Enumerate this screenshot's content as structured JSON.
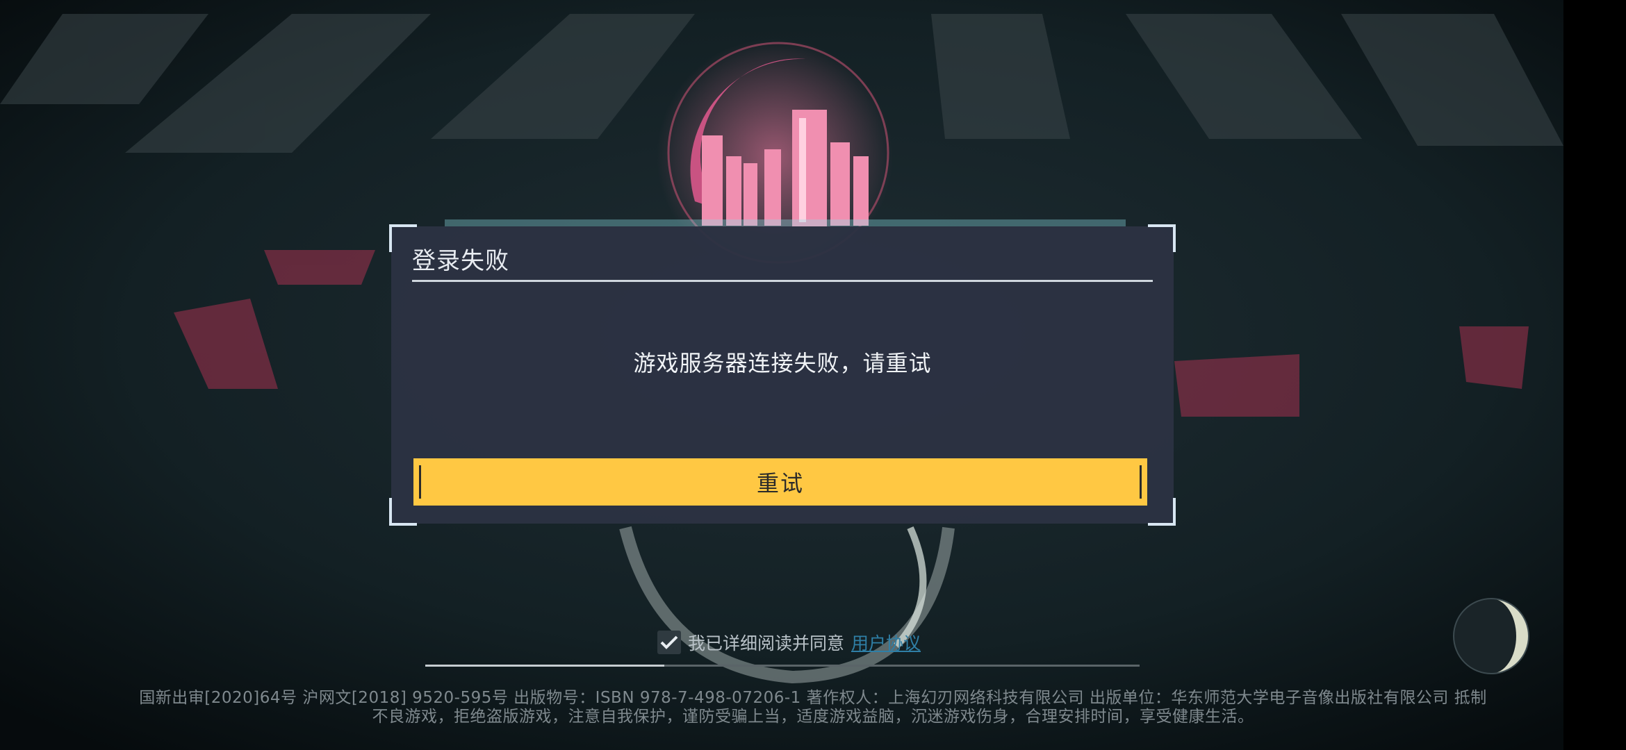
{
  "dialog": {
    "title": "登录失败",
    "message": "游戏服务器连接失败，请重试",
    "retry_label": "重试"
  },
  "agreement": {
    "checked": true,
    "text": "我已详细阅读并同意",
    "link_text": "用户协议"
  },
  "loading": {
    "progress": 0.335
  },
  "footer": {
    "line1": "国新出审[2020]64号   沪网文[2018] 9520-595号   出版物号：ISBN 978-7-498-07206-1   著作权人：上海幻刃网络科技有限公司   出版单位：华东师范大学电子音像出版社有限公司   抵制",
    "line2": "不良游戏，拒绝盗版游戏，注意自我保护，谨防受骗上当，适度游戏益脑，沉迷游戏伤身，合理安排时间，享受健康生活。"
  },
  "icons": {
    "checkbox": "checkmark-icon",
    "side_button": "moon-icon"
  },
  "colors": {
    "button_accent": "#ffc843",
    "dialog_bg": "#2c3243",
    "link": "#2f7fa6"
  }
}
